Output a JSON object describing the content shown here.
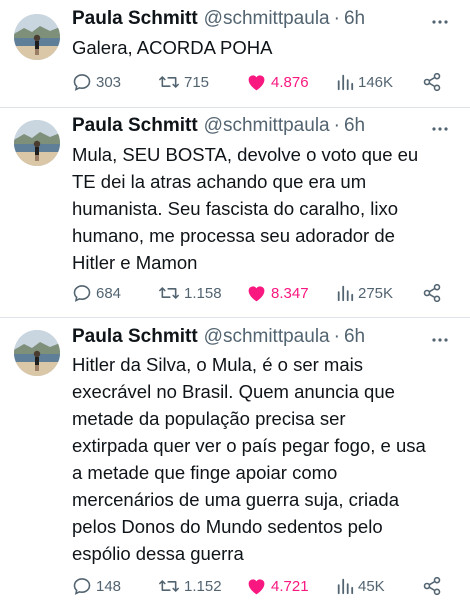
{
  "tweets": [
    {
      "name": "Paula Schmitt",
      "handle": "@schmittpaula",
      "separator": "·",
      "time": "6h",
      "text": "Galera, ACORDA POHA",
      "replies": "303",
      "retweets": "715",
      "likes": "4.876",
      "views": "146K",
      "liked": true
    },
    {
      "name": "Paula Schmitt",
      "handle": "@schmittpaula",
      "separator": "·",
      "time": "6h",
      "text": "Mula, SEU BOSTA, devolve o voto que eu\nTE dei la atras achando que era um\nhumanista. Seu fascista do caralho, lixo\nhumano, me processa seu adorador de\nHitler e Mamon",
      "replies": "684",
      "retweets": "1.158",
      "likes": "8.347",
      "views": "275K",
      "liked": true
    },
    {
      "name": "Paula Schmitt",
      "handle": "@schmittpaula",
      "separator": "·",
      "time": "6h",
      "text": "Hitler da Silva, o Mula, é o ser mais\nexecrável no Brasil. Quem anuncia que\nmetade da população precisa ser\nextirpada quer ver o país pegar fogo, e usa\na metade que finge apoiar como\nmercenários de uma guerra suja, criada\npelos Donos do Mundo sedentos pelo\nespólio dessa guerra",
      "replies": "148",
      "retweets": "1.152",
      "likes": "4.721",
      "views": "45K",
      "liked": true
    }
  ],
  "colors": {
    "text": "#0f1419",
    "muted": "#536471",
    "like": "#f91880",
    "divider": "#dde3e8"
  },
  "icons": {
    "reply": "speech-bubble-icon",
    "retweet": "retweet-icon",
    "like": "heart-filled-icon",
    "views": "bar-chart-icon",
    "share": "share-nodes-icon",
    "more": "three-dots-icon"
  }
}
